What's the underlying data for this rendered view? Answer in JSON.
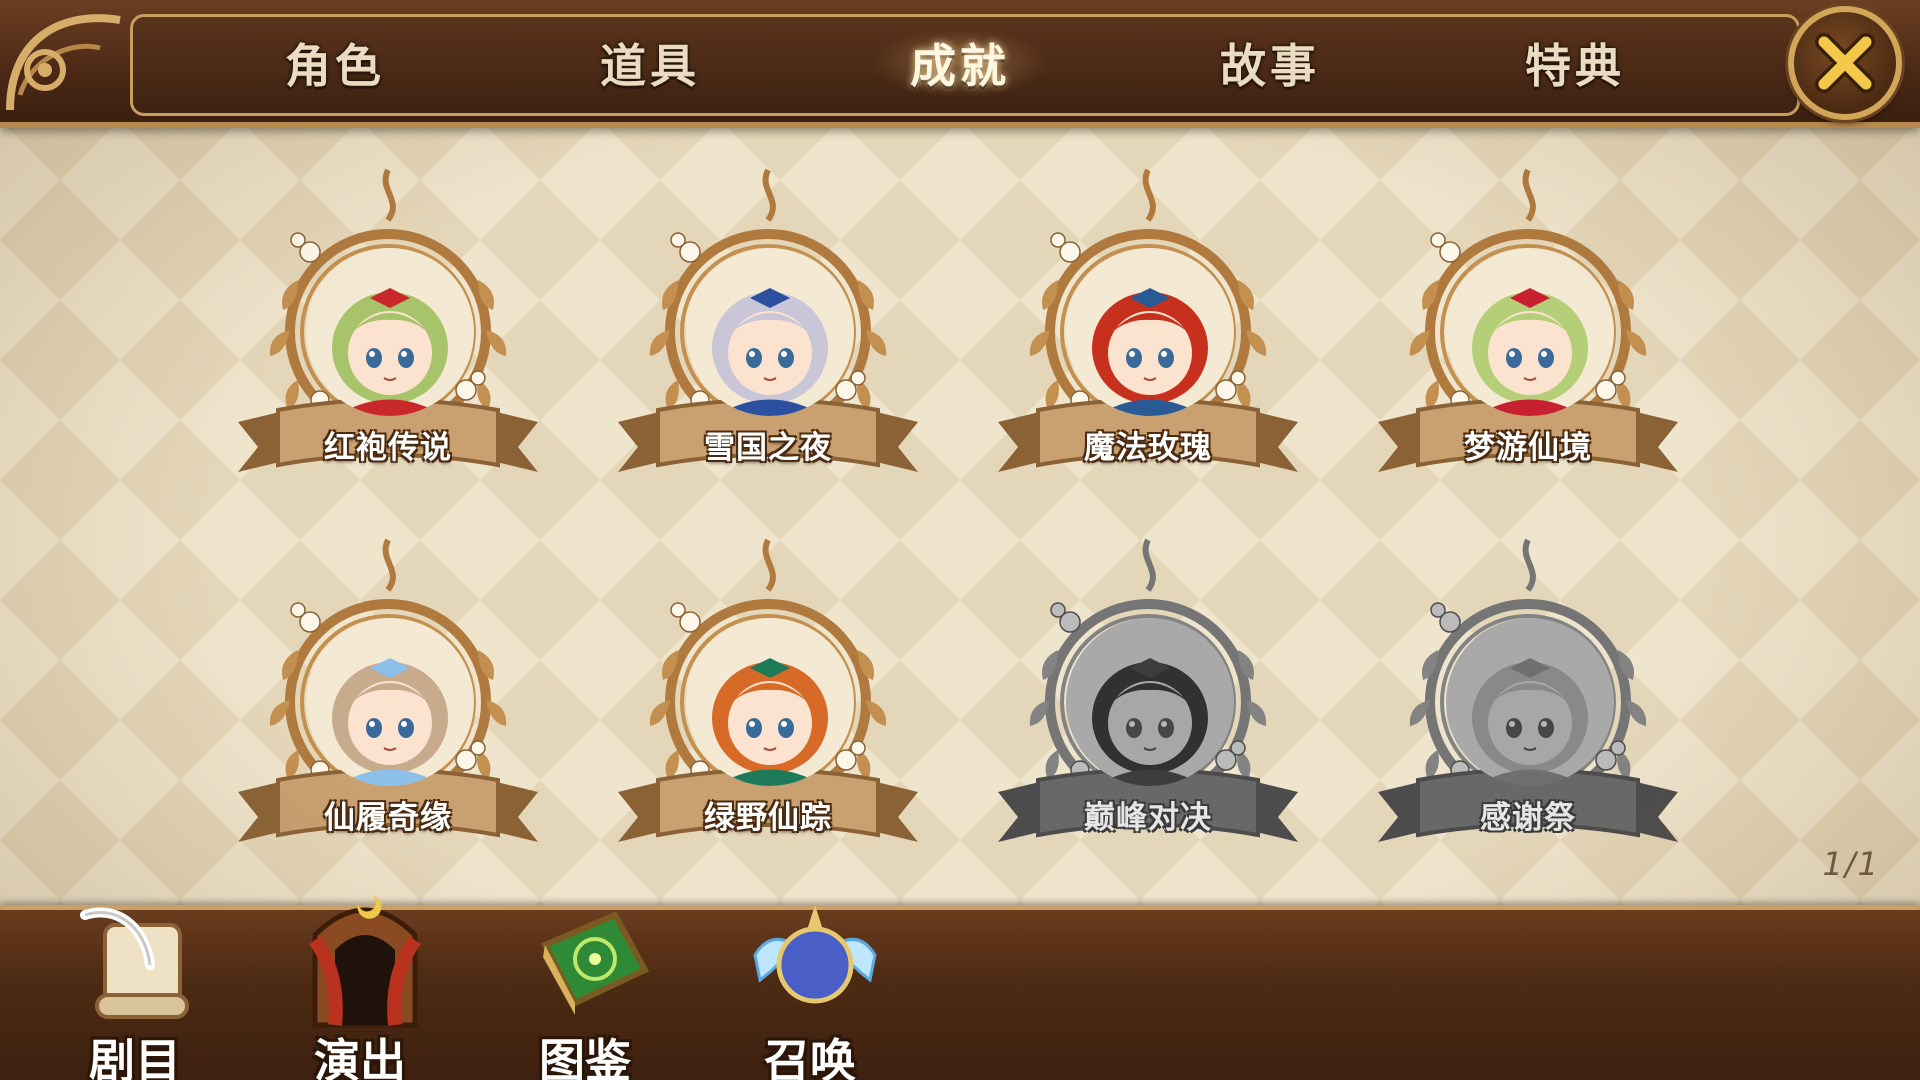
{
  "tabs": [
    {
      "label": "角色",
      "active": false
    },
    {
      "label": "道具",
      "active": false
    },
    {
      "label": "成就",
      "active": true
    },
    {
      "label": "故事",
      "active": false
    },
    {
      "label": "特典",
      "active": false
    }
  ],
  "close_icon": "close-x-icon",
  "achievements": [
    {
      "label": "红袍传说",
      "locked": false,
      "hair": "#a8c46a",
      "accent": "#c8282a"
    },
    {
      "label": "雪国之夜",
      "locked": false,
      "hair": "#c9c6d8",
      "accent": "#2c4fa0"
    },
    {
      "label": "魔法玫瑰",
      "locked": false,
      "hair": "#c8301e",
      "accent": "#2a5a96"
    },
    {
      "label": "梦游仙境",
      "locked": false,
      "hair": "#b4cf78",
      "accent": "#c82030"
    },
    {
      "label": "仙履奇缘",
      "locked": false,
      "hair": "#c8aa8c",
      "accent": "#8cc0e8"
    },
    {
      "label": "绿野仙踪",
      "locked": false,
      "hair": "#d86a28",
      "accent": "#1f7a5a"
    },
    {
      "label": "巅峰对决",
      "locked": true,
      "hair": "#444444",
      "accent": "#555555"
    },
    {
      "label": "感谢祭",
      "locked": true,
      "hair": "#bdbdbd",
      "accent": "#9a9a9a"
    }
  ],
  "page_indicator": "1/1",
  "bottom_nav": [
    {
      "label": "剧目",
      "icon": "scroll-quill-icon"
    },
    {
      "label": "演出",
      "icon": "stage-curtain-icon"
    },
    {
      "label": "图鉴",
      "icon": "green-book-icon"
    },
    {
      "label": "召唤",
      "icon": "winged-moon-orb-icon"
    }
  ]
}
